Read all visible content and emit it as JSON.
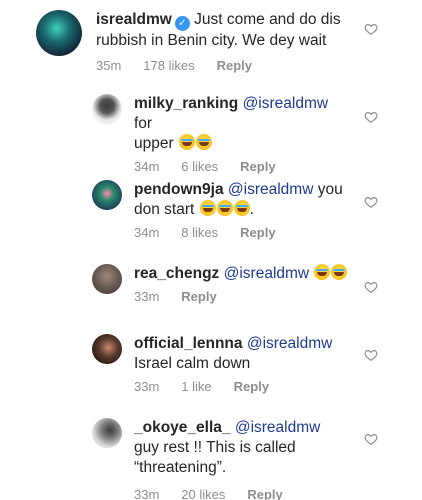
{
  "comments": [
    {
      "username": "isrealdmw",
      "verified": true,
      "text": "Just come and do dis rubbish in Benin city. We dey wait",
      "time": "35m",
      "likes": "178 likes",
      "reply": "Reply",
      "avatar_color": "#1a6b70"
    },
    {
      "username": "milky_ranking",
      "mention": "@isrealdmw",
      "text_before": "for",
      "text_after": "upper",
      "emoji_count": 2,
      "time": "34m",
      "likes": "6 likes",
      "reply": "Reply",
      "avatar_color": "#e8e8e8"
    },
    {
      "username": "pendown9ja",
      "mention": "@isrealdmw",
      "text_before": "you",
      "text_after": "don start",
      "emoji_count": 3,
      "trailing": ".",
      "time": "34m",
      "likes": "8 likes",
      "reply": "Reply",
      "avatar_color": "#2b8a6e"
    },
    {
      "username": "rea_chengz",
      "mention": "@isrealdmw",
      "emoji_count": 2,
      "time": "33m",
      "reply": "Reply",
      "avatar_color": "#6b5e57"
    },
    {
      "username": "official_lennna",
      "mention": "@isrealdmw",
      "text_after": "Israel calm down",
      "time": "33m",
      "likes": "1 like",
      "reply": "Reply",
      "avatar_color": "#5a3b2e"
    },
    {
      "username": "_okoye_ella_",
      "mention": "@isrealdmw",
      "text_after": "guy rest !! This is called",
      "text_line3": "“threatening”.",
      "time": "33m",
      "likes": "20 likes",
      "reply": "Reply",
      "avatar_color": "#d8d8d8"
    }
  ],
  "colors": {
    "mention": "#1f3a93",
    "meta": "#8e8e8e",
    "verified": "#3897f0"
  },
  "icons": {
    "like": "heart-outline-icon",
    "verified": "verified-badge-icon",
    "emoji": "tears-of-joy-emoji"
  }
}
